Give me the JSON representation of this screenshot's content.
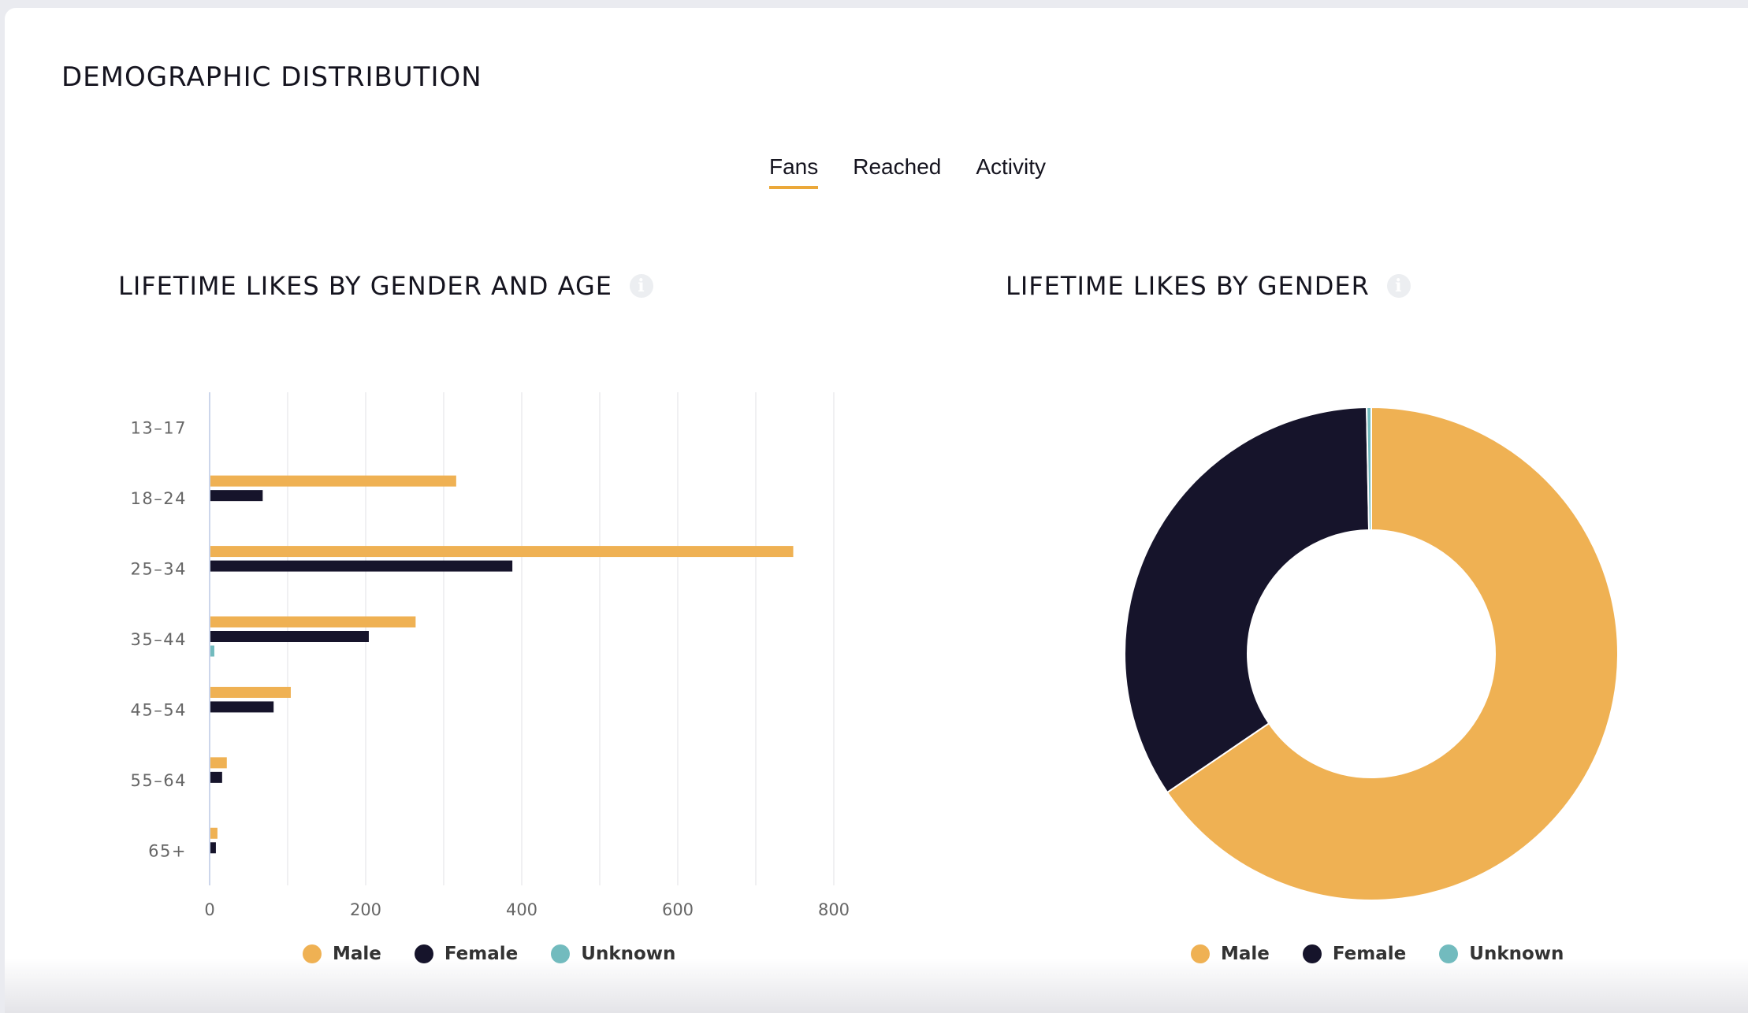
{
  "page": {
    "title": "DEMOGRAPHIC DISTRIBUTION"
  },
  "tabs": [
    {
      "label": "Fans",
      "active": true
    },
    {
      "label": "Reached",
      "active": false
    },
    {
      "label": "Activity",
      "active": false
    }
  ],
  "colors": {
    "male": "#efb153",
    "female": "#16142b",
    "unknown": "#72bbbe",
    "accent": "#eba83a"
  },
  "legend": [
    {
      "key": "male",
      "label": "Male"
    },
    {
      "key": "female",
      "label": "Female"
    },
    {
      "key": "unknown",
      "label": "Unknown"
    }
  ],
  "chart_data": [
    {
      "type": "bar",
      "orientation": "horizontal",
      "title": "LIFETIME LIKES BY GENDER AND AGE",
      "info_icon": "info-icon",
      "categories": [
        "13-17",
        "18-24",
        "25-34",
        "35-44",
        "45-54",
        "55-64",
        "65+"
      ],
      "series": [
        {
          "name": "Male",
          "values": [
            0,
            315,
            747,
            263,
            103,
            21,
            9
          ]
        },
        {
          "name": "Female",
          "values": [
            0,
            67,
            387,
            203,
            81,
            15,
            7
          ]
        },
        {
          "name": "Unknown",
          "values": [
            0,
            0,
            0,
            5,
            0,
            0,
            0
          ]
        }
      ],
      "xticks": [
        0,
        200,
        400,
        600,
        800
      ],
      "xlim": [
        0,
        800
      ],
      "grid": true,
      "legend_position": "bottom",
      "xlabel": "",
      "ylabel": ""
    },
    {
      "type": "pie",
      "donut": true,
      "title": "LIFETIME LIKES BY GENDER",
      "info_icon": "info-icon",
      "labels": [
        "Male",
        "Female",
        "Unknown"
      ],
      "values": [
        65.5,
        34.2,
        0.3
      ],
      "legend_position": "bottom"
    }
  ]
}
